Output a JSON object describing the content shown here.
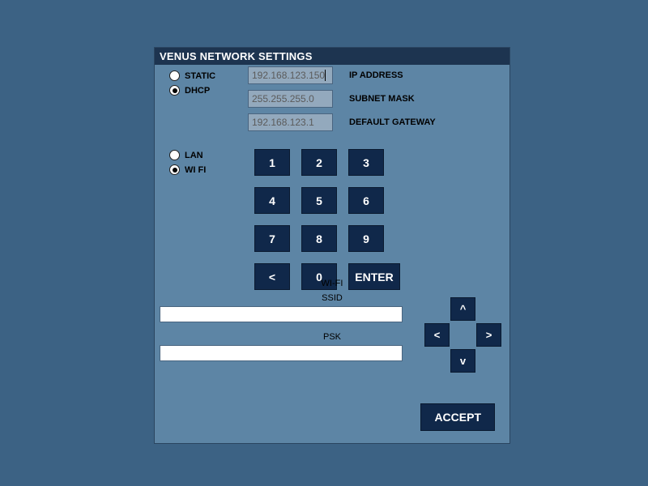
{
  "title": "VENUS NETWORK SETTINGS",
  "mode": {
    "static_label": "STATIC",
    "dhcp_label": "DHCP",
    "selected": "DHCP"
  },
  "conn": {
    "lan_label": "LAN",
    "wifi_label": "WI FI",
    "selected": "WI FI"
  },
  "fields": {
    "ip": {
      "value": "192.168.123.150",
      "label": "IP ADDRESS"
    },
    "mask": {
      "value": "255.255.255.0",
      "label": "SUBNET MASK"
    },
    "gateway": {
      "value": "192.168.123.1",
      "label": "DEFAULT GATEWAY"
    }
  },
  "keypad": {
    "k1": "1",
    "k2": "2",
    "k3": "3",
    "k4": "4",
    "k5": "5",
    "k6": "6",
    "k7": "7",
    "k8": "8",
    "k9": "9",
    "back": "<",
    "k0": "0",
    "enter": "ENTER"
  },
  "wifi": {
    "title": "WI-FI",
    "ssid_label": "SSID",
    "ssid_value": "",
    "psk_label": "PSK",
    "psk_value": ""
  },
  "dpad": {
    "up": "^",
    "down": "v",
    "left": "<",
    "right": ">"
  },
  "accept": "ACCEPT"
}
